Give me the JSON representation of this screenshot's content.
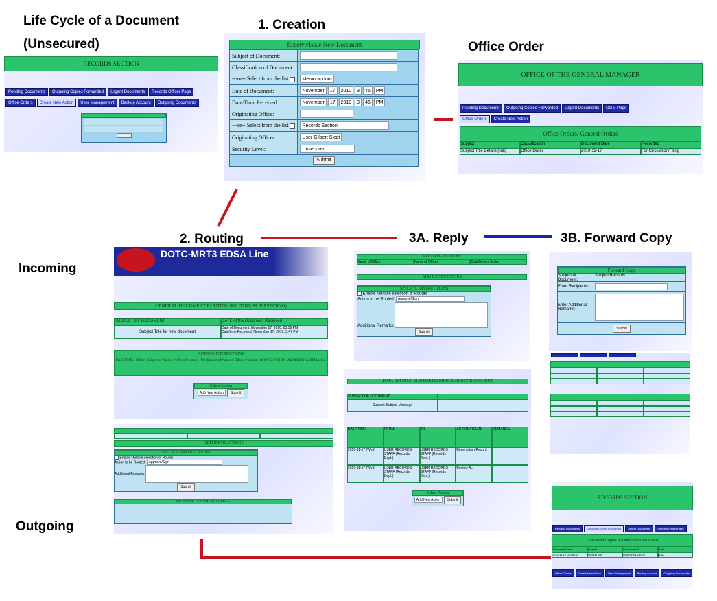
{
  "title_line1": "Life Cycle of a Document",
  "title_line2": "(Unsecured)",
  "stages": {
    "creation": "1. Creation",
    "office_order": "Office Order",
    "routing": "2. Routing",
    "reply": "3A. Reply",
    "forward": "3B. Forward Copy",
    "incoming": "Incoming",
    "outgoing": "Outgoing"
  },
  "colors": {
    "red_arrow": "#c8141e",
    "blue_arrow": "#1424b4",
    "green_bar": "#2bc36b",
    "tab_blue": "#1f2aa6"
  },
  "records_shot": {
    "header": "RECORDS SECTION",
    "tabs_row1": [
      "Pending Documents",
      "Outgoing Copies Forwarded",
      "Urgent Documents",
      "Records Officer Page"
    ],
    "tabs_row2": [
      "Office Orders",
      "Create New Action",
      "User Management",
      "Backup Account",
      "Outgoing Documents"
    ]
  },
  "creation_form": {
    "header": "Receive/Issue New Document",
    "fields": [
      "Subject of Document:",
      "Classification of Document:",
      "---or-- Select from the list",
      "Date of Document:",
      "Date/Time Received:",
      "Originating Office:",
      "---or-- Select from the list",
      "Originating Officer:",
      "Security Level:"
    ],
    "classification_select": "Memorandum",
    "date_month": "November",
    "date_day": "17",
    "date_year": "2010",
    "date_hour": "3",
    "date_minute": "46",
    "date_ampm": "PM",
    "office_select": "Records Section",
    "officer_select": "User Gilbert Sicat",
    "security_select": "Unsecured",
    "submit": "Submit"
  },
  "office_order_shot": {
    "header": "OFFICE OF THE GENERAL MANAGER",
    "tabs_row1": [
      "Pending Documents",
      "Outgoing Copies Forwarded",
      "Urgent Documents",
      "OGM Page"
    ],
    "tabs_row2": [
      "Office Orders",
      "Create New Action"
    ],
    "table_title": "Office Orders/ General Orders",
    "columns": [
      "Subject",
      "Classification",
      "Document Date",
      "Recorded"
    ],
    "row": [
      "Subject Title Details [link]",
      "Office Order",
      "2010-11-17",
      "For Circulation/Filing"
    ]
  },
  "routing_shot": {
    "banner": "DOTC-MRT3 EDSA Line",
    "title": "GENERAL DOCUMENT ROUTING ROUTING SLIP(PENDING)",
    "subject_label": "SUBJECT OF DOCUMENT",
    "subject_value": "Subject Title for new document",
    "dates_label": "DATE of the Document Received",
    "date_doc": "Date of Document: November 17, 2010, 03:59 PM",
    "date_recv": "Date/time Received: November 17, 2010, 3:47 PM",
    "action_title": "ACTION/INSTRUCTIONS",
    "columns": [
      "DATE/TIME",
      "FROM (Subject of Name of Officer/Position)",
      "TO (Subject of Name of Officer/Position)",
      "ROUTE/ACTION",
      "ADDITIONAL REMARKS"
    ],
    "action_label": "Select Action",
    "action_select": "Add New Action",
    "submit": "Submit"
  },
  "reply_shot": {
    "header": "ROUTING ACTIONS",
    "cols": [
      "Name of Office",
      "Name of Officer",
      "Date/time of Action"
    ],
    "section": "ADD INSTRUCTIONS",
    "subsection": "SPECIFIC INSTRUCTIONS",
    "check_label": "Enable Multiple selection of Routes",
    "route_label": "Action to be Routed:",
    "route_select": "Approve/Sign",
    "remarks_label": "Additional Remarks:",
    "submit": "Submit"
  },
  "reply_slip": {
    "title": "DATA ROUTING SLIP FOR PENDING SUBJECT DOCUMENT",
    "subject_label": "SUBJECT OF DOCUMENT",
    "subject_value": "Subject: Subject Message",
    "columns": [
      "DATE/TIME",
      "FROM",
      "TO",
      "ACTION/ROUTE",
      "REMARKS"
    ],
    "rows": [
      [
        "2010-11-17 (Wed)",
        "USER RECORDS STAFF (Records Dept.)",
        "USER RECORDS STAFF (Records Dept.)",
        "Reservation Record"
      ],
      [
        "2010-11-17 (Wed)",
        "USER RECORDS STAFF (Records Dept.)",
        "USER RECORDS STAFF (Records Dept.)",
        "Review Act"
      ]
    ],
    "action_label": "Select Action",
    "action_select": "Add New Action",
    "submit": "Submit"
  },
  "forward_shot": {
    "header": "Forward Copy",
    "fields": [
      "Subject of Document:",
      "Enter Recipients:",
      "Enter Additional Remarks:"
    ],
    "subject_value": "Subject/Records",
    "submit": "Submit"
  },
  "outgoing_shot": {
    "section": "ADD INSTRUCTIONS",
    "subsection": "SPECIFIC INSTRUCTIONS",
    "check_label": "Enable Multiple selection of Routes",
    "route_label": "Action to be Routed:",
    "route_select": "Approve/Sign",
    "remarks_label": "Additional Remarks:",
    "submit": "Submit",
    "bottom_title": "OUTGOING DOCUMENT DETAILS"
  },
  "records_bottom": {
    "header": "RECORDS SECTION",
    "tabs_row1": [
      "Pending Documents",
      "Outgoing Copies Forwarded",
      "Urgent Documents",
      "Records Officer Page"
    ],
    "table_title": "Forwarded Copies of Outbound Documents",
    "columns": [
      "Document Date",
      "Subject",
      "Forwarded To",
      "Date"
    ],
    "row": [
      "2010-11-17 03:59:00",
      "Subject Title",
      "USER RECORDS",
      "BSA"
    ],
    "tabs_row2": [
      "Office Orders",
      "Create New Action",
      "User Management",
      "Backup Account",
      "Outgoing Documents"
    ]
  }
}
